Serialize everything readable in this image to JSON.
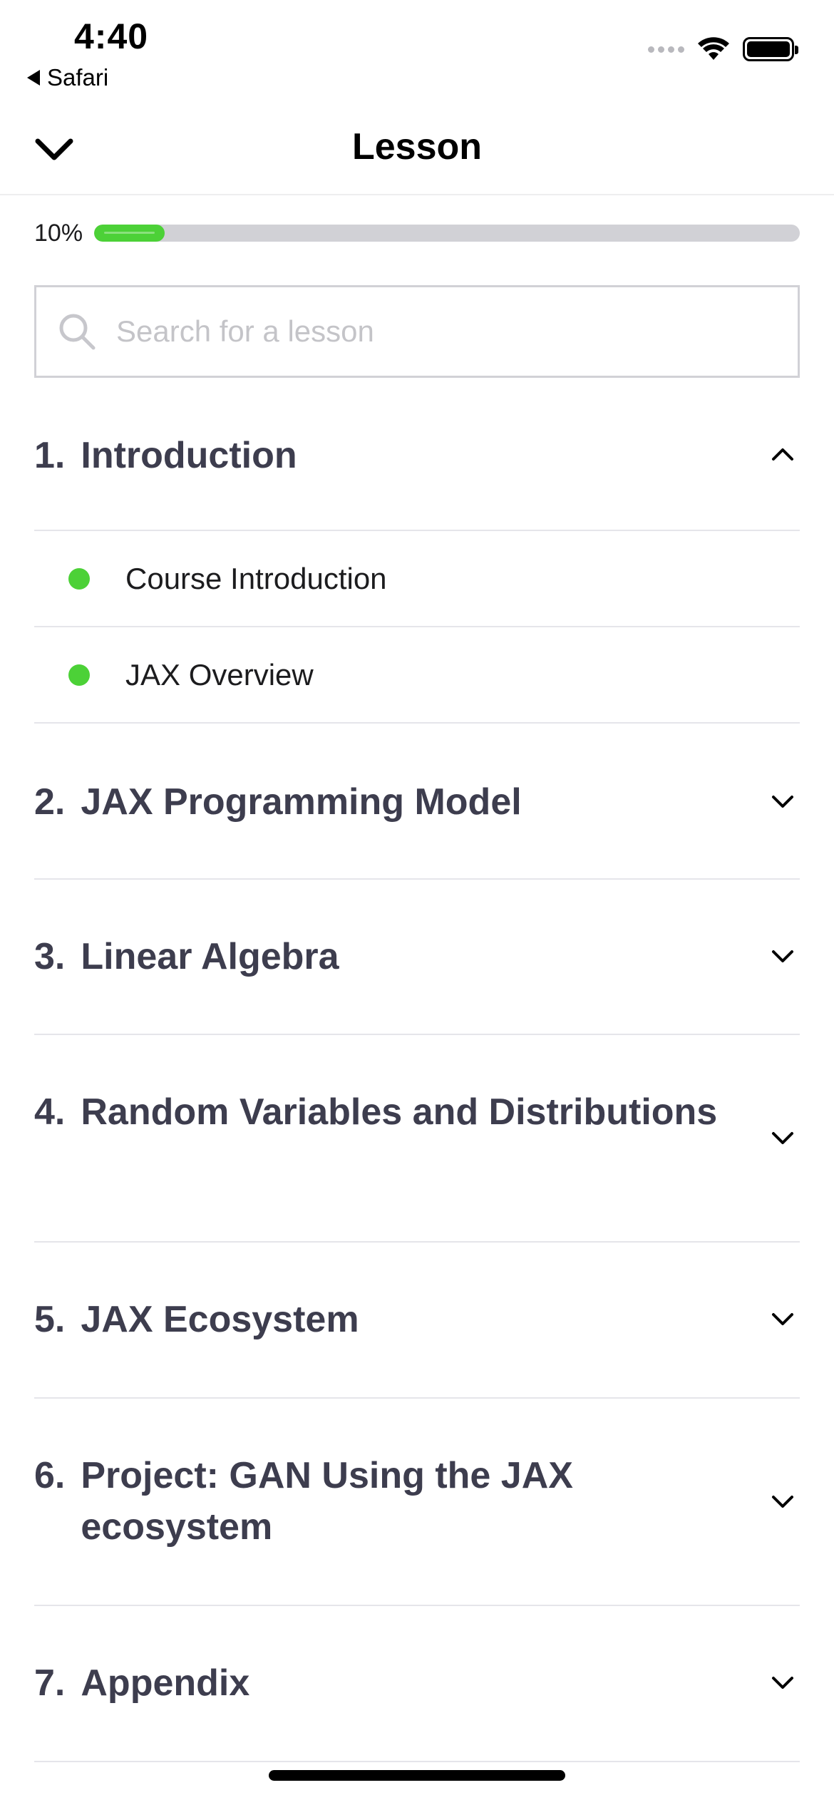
{
  "status_bar": {
    "time": "4:40",
    "back_app": "Safari",
    "icons": [
      "signal-icon",
      "wifi-icon",
      "battery-icon"
    ]
  },
  "header": {
    "title": "Lesson",
    "collapse_icon": "chevron-down-icon"
  },
  "progress": {
    "label": "10%",
    "value": 0.1,
    "fill_color": "#4cd137"
  },
  "search": {
    "placeholder": "Search for a lesson",
    "value": ""
  },
  "sections": [
    {
      "number": "1.",
      "title": "Introduction",
      "expanded": true,
      "lessons": [
        {
          "label": "Course Introduction",
          "status": "completed"
        },
        {
          "label": "JAX Overview",
          "status": "completed"
        }
      ]
    },
    {
      "number": "2.",
      "title": "JAX Programming Model",
      "expanded": false
    },
    {
      "number": "3.",
      "title": "Linear Algebra",
      "expanded": false
    },
    {
      "number": "4.",
      "title": "Random Variables and Distributions",
      "expanded": false
    },
    {
      "number": "5.",
      "title": "JAX Ecosystem",
      "expanded": false
    },
    {
      "number": "6.",
      "title": "Project: GAN Using the JAX ecosystem",
      "expanded": false
    },
    {
      "number": "7.",
      "title": "Appendix",
      "expanded": false
    }
  ],
  "colors": {
    "accent": "#4cd137",
    "section_text": "#3d3d4e",
    "divider": "#e5e5ea"
  }
}
